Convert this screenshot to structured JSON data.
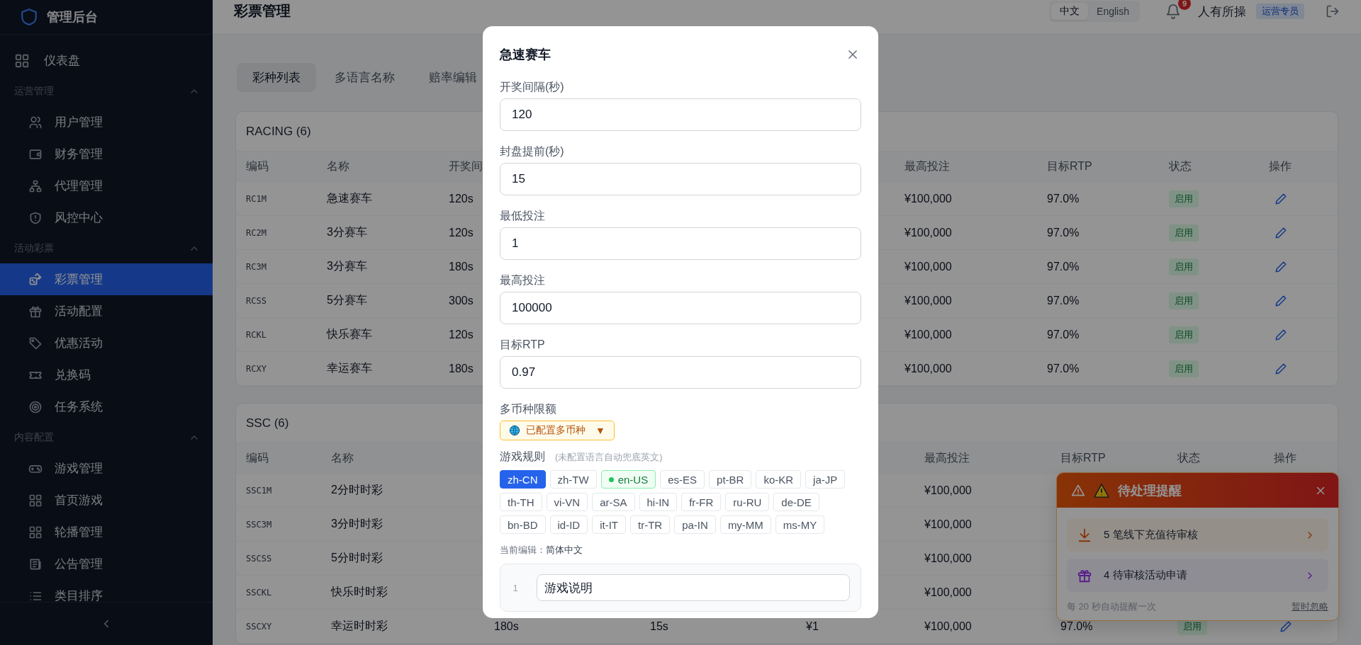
{
  "sidebar": {
    "title": "管理后台",
    "top_items": [
      {
        "label": "仪表盘",
        "selected": false
      }
    ],
    "sections": [
      {
        "title": "运营管理",
        "expanded": true,
        "items": [
          {
            "label": "用户管理",
            "selected": false
          },
          {
            "label": "财务管理",
            "selected": false
          },
          {
            "label": "代理管理",
            "selected": false
          },
          {
            "label": "风控中心",
            "selected": false
          }
        ]
      },
      {
        "title": "活动彩票",
        "expanded": true,
        "items": [
          {
            "label": "彩票管理",
            "selected": true
          },
          {
            "label": "活动配置",
            "selected": false
          },
          {
            "label": "优惠活动",
            "selected": false
          },
          {
            "label": "兑换码",
            "selected": false
          },
          {
            "label": "任务系统",
            "selected": false
          }
        ]
      },
      {
        "title": "内容配置",
        "expanded": true,
        "items": [
          {
            "label": "游戏管理",
            "selected": false
          },
          {
            "label": "首页游戏",
            "selected": false
          },
          {
            "label": "轮播管理",
            "selected": false
          },
          {
            "label": "公告管理",
            "selected": false
          },
          {
            "label": "类目排序",
            "selected": false
          }
        ]
      }
    ]
  },
  "topbar": {
    "title": "彩票管理",
    "languages": [
      {
        "label": "中文",
        "selected": true
      },
      {
        "label": "English",
        "selected": false
      }
    ],
    "notification_count": "9",
    "user": "人有所操",
    "role": "运营专员"
  },
  "tabs": [
    {
      "label": "彩种列表",
      "selected": true
    },
    {
      "label": "多语言名称",
      "selected": false
    },
    {
      "label": "赔率编辑",
      "selected": false
    }
  ],
  "tables": [
    {
      "title": "RACING (6)",
      "columns": [
        "编码",
        "名称",
        "开奖间",
        "最高投注",
        "目标RTP",
        "状态",
        "操作"
      ],
      "rows": [
        {
          "code": "RC1M",
          "name": "急速赛车",
          "interval": "120s",
          "max_bet": "¥100,000",
          "rtp": "97.0%",
          "status": "启用",
          "editable": true
        },
        {
          "code": "RC2M",
          "name": "3分赛车",
          "interval": "120s",
          "max_bet": "¥100,000",
          "rtp": "97.0%",
          "status": "启用",
          "editable": true
        },
        {
          "code": "RC3M",
          "name": "3分赛车",
          "interval": "180s",
          "max_bet": "¥100,000",
          "rtp": "97.0%",
          "status": "启用",
          "editable": true
        },
        {
          "code": "RCSS",
          "name": "5分赛车",
          "interval": "300s",
          "max_bet": "¥100,000",
          "rtp": "97.0%",
          "status": "启用",
          "editable": true
        },
        {
          "code": "RCKL",
          "name": "快乐赛车",
          "interval": "120s",
          "max_bet": "¥100,000",
          "rtp": "97.0%",
          "status": "启用",
          "editable": true
        },
        {
          "code": "RCXY",
          "name": "幸运赛车",
          "interval": "180s",
          "max_bet": "¥100,000",
          "rtp": "97.0%",
          "status": "启用",
          "editable": true
        }
      ]
    },
    {
      "title": "SSC (6)",
      "columns": [
        "编码",
        "名称",
        "最高投注",
        "目标RTP",
        "状态",
        "操作"
      ],
      "rows": [
        {
          "code": "SSC1M",
          "name": "2分时时彩",
          "max_bet": "¥100,000",
          "editable": false
        },
        {
          "code": "SSC3M",
          "name": "3分时时彩",
          "max_bet": "¥100,000",
          "editable": false
        },
        {
          "code": "SSCSS",
          "name": "5分时时彩",
          "max_bet": "¥100,000",
          "editable": false
        },
        {
          "code": "SSCKL",
          "name": "快乐时时彩",
          "max_bet": "¥100,000",
          "editable": false
        },
        {
          "code": "SSCXY",
          "name": "幸运时时彩",
          "interval": "180s",
          "lock": "15s",
          "min_bet": "¥1",
          "max_bet": "¥100,000",
          "rtp": "97.0%",
          "status": "启用",
          "editable": true
        }
      ]
    }
  ],
  "alert": {
    "title": "待处理提醒",
    "items": [
      {
        "kind": "deposit",
        "text": "5 笔线下充值待审核"
      },
      {
        "kind": "activity",
        "text": "4 待审核活动申请"
      }
    ],
    "footer": "每 20 秒自动提醒一次",
    "dismiss": "暂时忽略"
  },
  "modal": {
    "title": "急速赛车",
    "fields": [
      {
        "label": "开奖间隔(秒)",
        "value": "120"
      },
      {
        "label": "封盘提前(秒)",
        "value": "15"
      },
      {
        "label": "最低投注",
        "value": "1"
      },
      {
        "label": "最高投注",
        "value": "100000"
      },
      {
        "label": "目标RTP",
        "value": "0.97"
      }
    ],
    "currency": {
      "label": "多币种限额",
      "button": "已配置多币种",
      "caret": "▼"
    },
    "rules": {
      "label": "游戏规则",
      "hint": "(未配置语言自动兜底英文)",
      "languages": [
        {
          "code": "zh-CN",
          "selected": true,
          "configured": false
        },
        {
          "code": "zh-TW",
          "selected": false,
          "configured": false
        },
        {
          "code": "en-US",
          "selected": false,
          "configured": true
        },
        {
          "code": "es-ES",
          "selected": false,
          "configured": false
        },
        {
          "code": "pt-BR",
          "selected": false,
          "configured": false
        },
        {
          "code": "ko-KR",
          "selected": false,
          "configured": false
        },
        {
          "code": "ja-JP",
          "selected": false,
          "configured": false
        },
        {
          "code": "th-TH",
          "selected": false,
          "configured": false
        },
        {
          "code": "vi-VN",
          "selected": false,
          "configured": false
        },
        {
          "code": "ar-SA",
          "selected": false,
          "configured": false
        },
        {
          "code": "hi-IN",
          "selected": false,
          "configured": false
        },
        {
          "code": "fr-FR",
          "selected": false,
          "configured": false
        },
        {
          "code": "ru-RU",
          "selected": false,
          "configured": false
        },
        {
          "code": "de-DE",
          "selected": false,
          "configured": false
        },
        {
          "code": "bn-BD",
          "selected": false,
          "configured": false
        },
        {
          "code": "id-ID",
          "selected": false,
          "configured": false
        },
        {
          "code": "it-IT",
          "selected": false,
          "configured": false
        },
        {
          "code": "tr-TR",
          "selected": false,
          "configured": false
        },
        {
          "code": "pa-IN",
          "selected": false,
          "configured": false
        },
        {
          "code": "my-MM",
          "selected": false,
          "configured": false
        },
        {
          "code": "ms-MY",
          "selected": false,
          "configured": false
        }
      ],
      "editing_label": "当前编辑：",
      "editing_value": "简体中文",
      "lines": [
        {
          "number": "1",
          "value": "游戏说明"
        }
      ]
    }
  }
}
